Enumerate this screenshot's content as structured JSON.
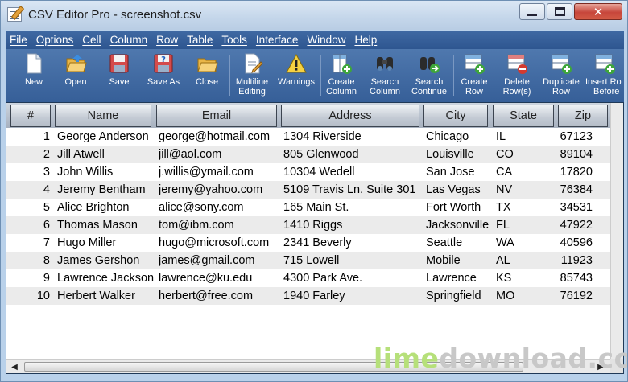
{
  "window": {
    "title": "CSV Editor Pro - screenshot.csv"
  },
  "menu": [
    "File",
    "Options",
    "Cell",
    "Column",
    "Row",
    "Table",
    "Tools",
    "Interface",
    "Window",
    "Help"
  ],
  "toolbar": [
    {
      "label1": "New",
      "label2": "",
      "icon": "new-file-icon"
    },
    {
      "label1": "Open",
      "label2": "",
      "icon": "open-folder-icon"
    },
    {
      "label1": "Save",
      "label2": "",
      "icon": "save-disk-icon"
    },
    {
      "label1": "Save As",
      "label2": "",
      "icon": "save-as-icon"
    },
    {
      "label1": "Close",
      "label2": "",
      "icon": "close-folder-icon"
    },
    {
      "label1": "Multiline",
      "label2": "Editing",
      "icon": "multiline-edit-icon"
    },
    {
      "label1": "Warnings",
      "label2": "",
      "icon": "warning-icon"
    },
    {
      "label1": "Create",
      "label2": "Column",
      "icon": "create-column-icon"
    },
    {
      "label1": "Search",
      "label2": "Column",
      "icon": "binoculars-icon"
    },
    {
      "label1": "Search",
      "label2": "Continue",
      "icon": "search-continue-icon"
    },
    {
      "label1": "Create",
      "label2": "Row",
      "icon": "create-row-icon"
    },
    {
      "label1": "Delete",
      "label2": "Row(s)",
      "icon": "delete-row-icon"
    },
    {
      "label1": "Duplicate",
      "label2": "Row",
      "icon": "duplicate-row-icon"
    },
    {
      "label1": "Insert Ro",
      "label2": "Before",
      "icon": "insert-row-icon"
    }
  ],
  "table": {
    "columns": [
      "#",
      "Name",
      "Email",
      "Address",
      "City",
      "State",
      "Zip"
    ],
    "rows": [
      [
        "1",
        "George Anderson",
        "george@hotmail.com",
        "1304 Riverside",
        "Chicago",
        "IL",
        "67123"
      ],
      [
        "2",
        "Jill Atwell",
        "jill@aol.com",
        "805 Glenwood",
        "Louisville",
        "CO",
        "89104"
      ],
      [
        "3",
        "John Willis",
        "j.willis@ymail.com",
        "10304 Wedell",
        "San Jose",
        "CA",
        "17820"
      ],
      [
        "4",
        "Jeremy Bentham",
        "jeremy@yahoo.com",
        "5109 Travis Ln. Suite 301",
        "Las Vegas",
        "NV",
        "76384"
      ],
      [
        "5",
        "Alice Brighton",
        "alice@sony.com",
        "165 Main St.",
        "Fort Worth",
        "TX",
        "34531"
      ],
      [
        "6",
        "Thomas Mason",
        "tom@ibm.com",
        "1410 Riggs",
        "Jacksonville",
        "FL",
        "47922"
      ],
      [
        "7",
        "Hugo Miller",
        "hugo@microsoft.com",
        "2341 Beverly",
        "Seattle",
        "WA",
        "40596"
      ],
      [
        "8",
        "James Gershon",
        "james@gmail.com",
        "715 Lowell",
        "Mobile",
        "AL",
        "11923"
      ],
      [
        "9",
        "Lawrence Jackson",
        "lawrence@ku.edu",
        "4300 Park Ave.",
        "Lawrence",
        "KS",
        "85743"
      ],
      [
        "10",
        "Herbert Walker",
        "herbert@free.com",
        "1940 Farley",
        "Springfield",
        "MO",
        "76192"
      ]
    ]
  },
  "watermark": {
    "part1": "lime",
    "part2": "download.com"
  },
  "colors": {
    "menubar": "#2e5690",
    "toolbar": "#4f78ae",
    "header": "#c3cad4",
    "alt_row": "#ebebeb"
  }
}
